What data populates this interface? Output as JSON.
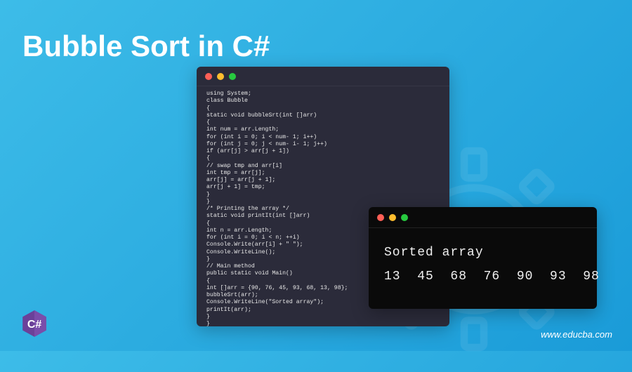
{
  "title": "Bubble Sort in C#",
  "code_window": {
    "content": "using System;\nclass Bubble\n{\nstatic void bubbleSrt(int []arr)\n{\nint num = arr.Length;\nfor (int i = 0; i < num- 1; i++)\nfor (int j = 0; j < num- i- 1; j++)\nif (arr[j] > arr[j + 1])\n{\n// swap tmp and arr[i]\nint tmp = arr[j];\narr[j] = arr[j + 1];\narr[j + 1] = tmp;\n}\n}\n/* Printing the array */\nstatic void printIt(int []arr)\n{\nint n = arr.Length;\nfor (int i = 0; i < n; ++i)\nConsole.Write(arr[i] + \" \");\nConsole.WriteLine();\n}\n// Main method\npublic static void Main()\n{\nint []arr = {90, 76, 45, 93, 68, 13, 98};\nbubbleSrt(arr);\nConsole.WriteLine(\"Sorted array\");\nprintIt(arr);\n}\n}"
  },
  "output_window": {
    "line1": "Sorted array",
    "line2": "13  45  68  76  90  93  98"
  },
  "footer": {
    "url": "www.educba.com"
  },
  "logo": {
    "label": "C#"
  },
  "colors": {
    "bg_start": "#3dbce8",
    "bg_end": "#1a9bd8",
    "code_bg": "#2b2b3a",
    "output_bg": "#0a0a0a",
    "text_white": "#ffffff",
    "logo_purple": "#6b4199"
  }
}
